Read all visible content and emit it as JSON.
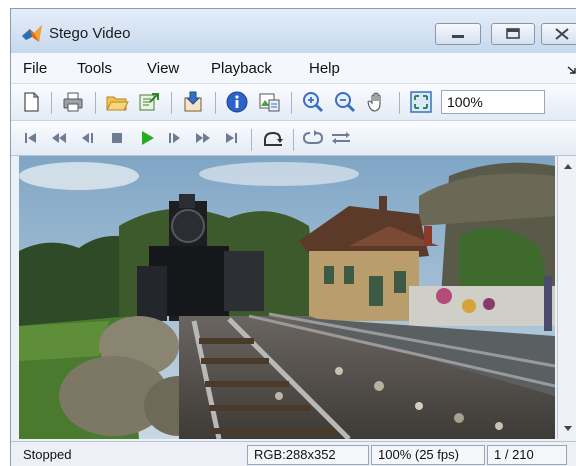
{
  "window": {
    "title": "Stego Video"
  },
  "menu": [
    "File",
    "Tools",
    "View",
    "Playback",
    "Help"
  ],
  "toolbar": {
    "icons": [
      "new-file-icon",
      "print-icon",
      "open-folder-icon",
      "export-icon",
      "extract-icon",
      "info-icon",
      "image-tool-icon",
      "zoom-in-icon",
      "zoom-out-icon",
      "pan-hand-icon",
      "fit-to-window-icon"
    ],
    "zoom_value": "100%"
  },
  "playback_controls": [
    "go-to-first-icon",
    "rewind-icon",
    "step-back-icon",
    "stop-icon",
    "play-icon",
    "step-forward-icon",
    "fast-forward-icon",
    "go-to-last-icon",
    "jump-to-icon",
    "loop-icon",
    "play-direction-icon"
  ],
  "colors": {
    "play": "#22b022",
    "controls": "#6f7d93",
    "title_bar": "#c7d8ee"
  },
  "status": {
    "state": "Stopped",
    "video_info": "RGB:288x352",
    "zoom_fps": "100% (25 fps)",
    "frame": "1 / 210"
  }
}
